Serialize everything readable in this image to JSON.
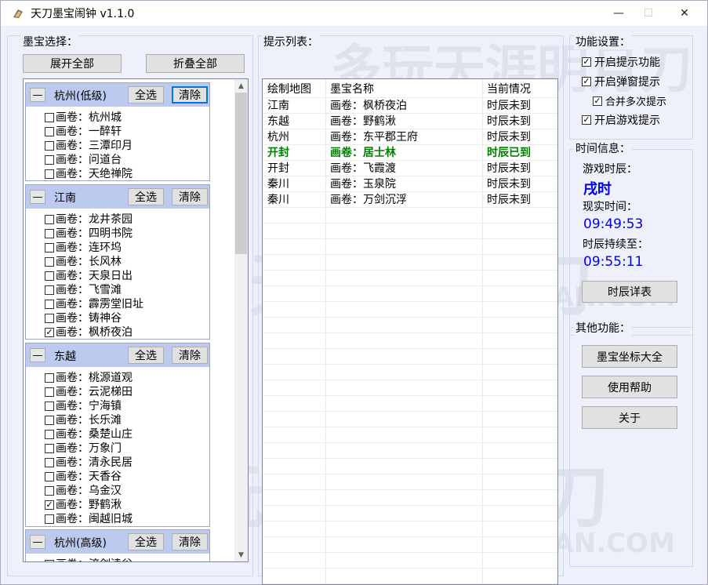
{
  "window": {
    "title": "天刀墨宝闹钟 v1.1.0",
    "minimize": "—",
    "maximize": "☐",
    "close": "✕"
  },
  "watermark": {
    "text1": "多玩天涯明月刀",
    "text2": "WUXIA.DUOWAN.COM"
  },
  "left": {
    "group_label": "墨宝选择：",
    "expand_all": "展开全部",
    "collapse_all": "折叠全部",
    "select_all": "全选",
    "clear": "清除",
    "categories": [
      {
        "name": "杭州(低级)",
        "items": [
          {
            "label": "画卷：杭州城",
            "checked": false
          },
          {
            "label": "画卷：一醉轩",
            "checked": false
          },
          {
            "label": "画卷：三潭印月",
            "checked": false
          },
          {
            "label": "画卷：问道台",
            "checked": false
          },
          {
            "label": "画卷：天绝禅院",
            "checked": false
          }
        ]
      },
      {
        "name": "江南",
        "items": [
          {
            "label": "画卷：龙井茶园",
            "checked": false
          },
          {
            "label": "画卷：四明书院",
            "checked": false
          },
          {
            "label": "画卷：连环坞",
            "checked": false
          },
          {
            "label": "画卷：长风林",
            "checked": false
          },
          {
            "label": "画卷：天泉日出",
            "checked": false
          },
          {
            "label": "画卷：飞雪滩",
            "checked": false
          },
          {
            "label": "画卷：霹雳堂旧址",
            "checked": false
          },
          {
            "label": "画卷：铸神谷",
            "checked": false
          },
          {
            "label": "画卷：枫桥夜泊",
            "checked": true
          }
        ]
      },
      {
        "name": "东越",
        "items": [
          {
            "label": "画卷：桃源道观",
            "checked": false
          },
          {
            "label": "画卷：云泥梯田",
            "checked": false
          },
          {
            "label": "画卷：宁海镇",
            "checked": false
          },
          {
            "label": "画卷：长乐滩",
            "checked": false
          },
          {
            "label": "画卷：桑楚山庄",
            "checked": false
          },
          {
            "label": "画卷：万象门",
            "checked": false
          },
          {
            "label": "画卷：清永民居",
            "checked": false
          },
          {
            "label": "画卷：天香谷",
            "checked": false
          },
          {
            "label": "画卷：乌金汉",
            "checked": false
          },
          {
            "label": "画卷：野鹤湫",
            "checked": true
          },
          {
            "label": "画卷：闽越旧城",
            "checked": false
          }
        ]
      },
      {
        "name": "杭州(高级)",
        "items": [
          {
            "label": "画卷：淬剑渎谷",
            "checked": false
          }
        ]
      }
    ]
  },
  "middle": {
    "group_label": "提示列表：",
    "columns": [
      "绘制地图",
      "墨宝名称",
      "当前情况"
    ],
    "rows": [
      {
        "map": "江南",
        "name": "画卷：枫桥夜泊",
        "status": "时辰未到",
        "highlight": false
      },
      {
        "map": "东越",
        "name": "画卷：野鹤湫",
        "status": "时辰未到",
        "highlight": false
      },
      {
        "map": "杭州",
        "name": "画卷：东平郡王府",
        "status": "时辰未到",
        "highlight": false
      },
      {
        "map": "开封",
        "name": "画卷：居士林",
        "status": "时辰已到",
        "highlight": true
      },
      {
        "map": "开封",
        "name": "画卷：飞霞渡",
        "status": "时辰未到",
        "highlight": false
      },
      {
        "map": "秦川",
        "name": "画卷：玉泉院",
        "status": "时辰未到",
        "highlight": false
      },
      {
        "map": "秦川",
        "name": "画卷：万剑沉浮",
        "status": "时辰未到",
        "highlight": false
      }
    ],
    "highlight_color": "#008000"
  },
  "settings": {
    "group_label": "功能设置：",
    "options": [
      {
        "label": "开启提示功能",
        "checked": true
      },
      {
        "label": "开启弹窗提示",
        "checked": true
      },
      {
        "label": "合并多次提示",
        "checked": true
      },
      {
        "label": "开启游戏提示",
        "checked": true
      }
    ]
  },
  "time": {
    "group_label": "时间信息：",
    "game_hour_label": "游戏时辰：",
    "game_hour": "戌时",
    "real_time_label": "现实时间：",
    "real_time": "09:49:53",
    "lasts_until_label": "时辰持续至：",
    "lasts_until": "09:55:11",
    "detail_button": "时辰详表"
  },
  "other": {
    "group_label": "其他功能：",
    "buttons": [
      "墨宝坐标大全",
      "使用帮助",
      "关于"
    ]
  }
}
